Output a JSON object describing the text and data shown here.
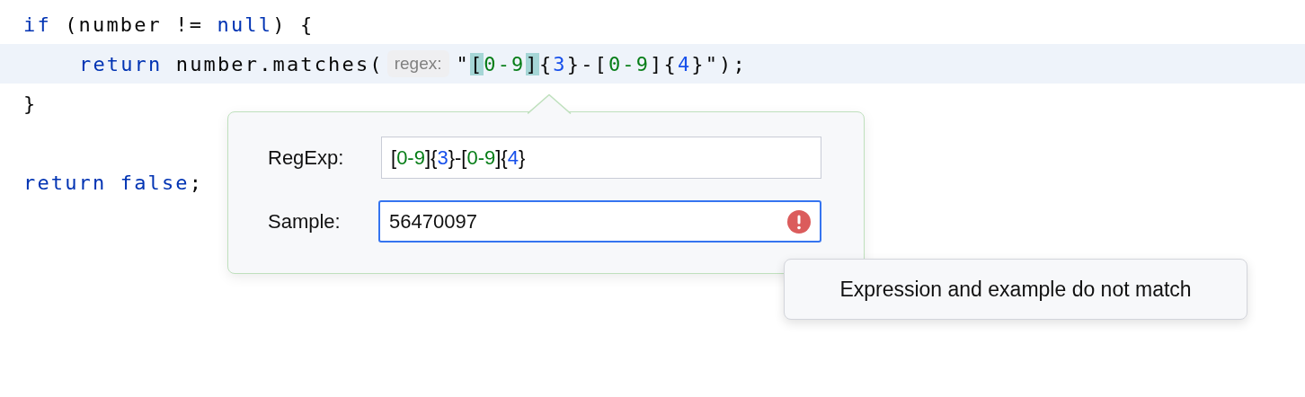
{
  "editor": {
    "lines": [
      {
        "current": false,
        "tokens": [
          {
            "kind": "keyword",
            "text": "if"
          },
          {
            "kind": "plain",
            "text": " (number != "
          },
          {
            "kind": "keyword",
            "text": "null"
          },
          {
            "kind": "plain",
            "text": ") {"
          }
        ],
        "children": [
          {
            "current": true,
            "tokens": [
              {
                "kind": "keyword",
                "text": "return"
              },
              {
                "kind": "plain",
                "text": " number.matches("
              },
              {
                "kind": "hint",
                "text": "regex:"
              },
              {
                "kind": "plain",
                "text": "\""
              },
              {
                "kind": "match",
                "text": "["
              },
              {
                "kind": "range",
                "text": "0-9"
              },
              {
                "kind": "match",
                "text": "]"
              },
              {
                "kind": "plain",
                "text": "{"
              },
              {
                "kind": "count",
                "text": "3"
              },
              {
                "kind": "plain",
                "text": "}-["
              },
              {
                "kind": "range",
                "text": "0-9"
              },
              {
                "kind": "plain",
                "text": "]{"
              },
              {
                "kind": "count",
                "text": "4"
              },
              {
                "kind": "plain",
                "text": "}\");"
              }
            ]
          }
        ]
      },
      {
        "current": false,
        "tokens": [
          {
            "kind": "plain",
            "text": "}"
          }
        ]
      },
      {
        "current": false,
        "blank_line_before": true,
        "tokens": [
          {
            "kind": "keyword",
            "text": "return "
          },
          {
            "kind": "keyword",
            "text": "false"
          },
          {
            "kind": "plain",
            "text": ";"
          }
        ]
      }
    ]
  },
  "popup": {
    "regexp": {
      "label": "RegExp:",
      "focused": false,
      "tokens": [
        {
          "kind": "plain",
          "text": "["
        },
        {
          "kind": "range",
          "text": "0-9"
        },
        {
          "kind": "plain",
          "text": "]{"
        },
        {
          "kind": "count",
          "text": "3"
        },
        {
          "kind": "plain",
          "text": "}-["
        },
        {
          "kind": "range",
          "text": "0-9"
        },
        {
          "kind": "plain",
          "text": "]{"
        },
        {
          "kind": "count",
          "text": "4"
        },
        {
          "kind": "plain",
          "text": "}"
        }
      ]
    },
    "sample": {
      "label": "Sample:",
      "value": "56470097",
      "focused": true,
      "error": true
    }
  },
  "tooltip": {
    "text": "Expression and example do not match"
  }
}
